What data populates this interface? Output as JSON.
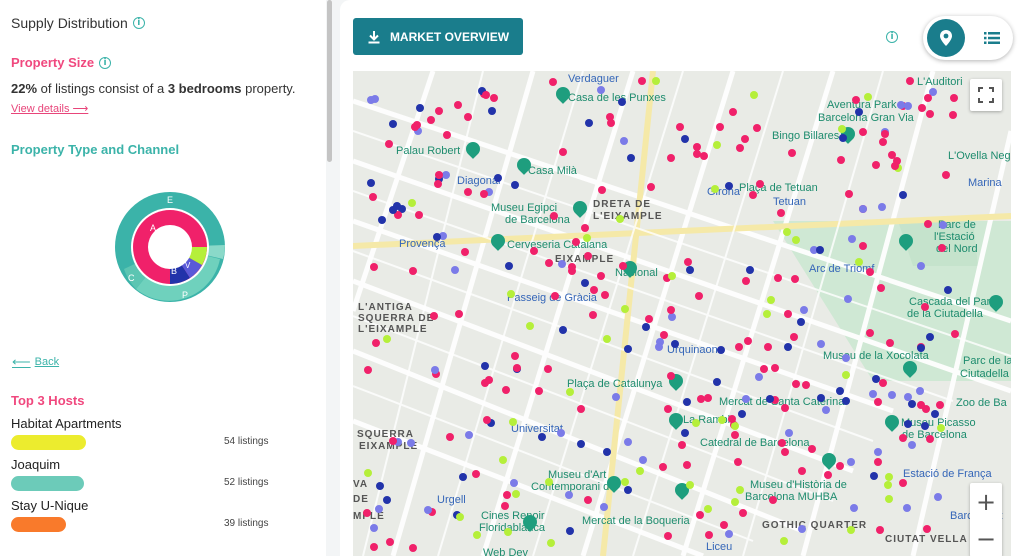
{
  "left": {
    "title": "Supply Distribution",
    "property_size": {
      "heading": "Property Size",
      "percent": "22%",
      "text_mid": " of listings consist of a ",
      "bold_value": "3 bedrooms",
      "text_end": " property.",
      "view_details": "View details ⟶"
    },
    "type_channel": {
      "heading": "Property Type and Channel",
      "donut_labels": {
        "E": "E",
        "A": "A",
        "B": "B",
        "V": "V",
        "C": "C",
        "P": "P"
      }
    },
    "back": "Back",
    "top_hosts": {
      "heading": "Top 3 Hosts",
      "hosts": [
        {
          "name": "Habitat Apartments",
          "count": "54 listings",
          "color": "#ecec2e"
        },
        {
          "name": "Joaquim",
          "count": "52 listings",
          "color": "#6ccbb9"
        },
        {
          "name": "Stay U-Nique",
          "count": "39 listings",
          "color": "#f97a2b"
        }
      ]
    }
  },
  "right": {
    "market_overview": "MARKET OVERVIEW",
    "view_toggle": {
      "active": "map-view",
      "inactive": "list-view"
    }
  },
  "map": {
    "labels": [
      {
        "text": "Verdaguer",
        "cls": "ml-blue"
      },
      {
        "text": "Casa de les Punxes",
        "cls": "ml-teal"
      },
      {
        "text": "L'Auditori",
        "cls": "ml-teal"
      },
      {
        "text": "Aventura Park",
        "cls": "ml-teal"
      },
      {
        "text": "Barcelona Gran Via",
        "cls": "ml-teal"
      },
      {
        "text": "Bingo Billares",
        "cls": "ml-teal"
      },
      {
        "text": "Palau Robert",
        "cls": "ml-teal"
      },
      {
        "text": "Casa Milà",
        "cls": "ml-teal"
      },
      {
        "text": "L'Ovella Negra",
        "cls": "ml-teal"
      },
      {
        "text": "Diagonal",
        "cls": "ml-blue"
      },
      {
        "text": "Girona",
        "cls": "ml-blue"
      },
      {
        "text": "Plaça de Tetuan",
        "cls": "ml-teal"
      },
      {
        "text": "Marina",
        "cls": "ml-blue"
      },
      {
        "text": "Museu Egipci",
        "cls": "ml-teal"
      },
      {
        "text": "de Barcelona",
        "cls": "ml-teal"
      },
      {
        "text": "DRETA DE",
        "cls": "ml-gray"
      },
      {
        "text": "L'EIXAMPLE",
        "cls": "ml-gray"
      },
      {
        "text": "Tetuan",
        "cls": "ml-blue"
      },
      {
        "text": "Parc de",
        "cls": "ml-teal"
      },
      {
        "text": "l'Estació",
        "cls": "ml-teal"
      },
      {
        "text": "del Nord",
        "cls": "ml-teal"
      },
      {
        "text": "Provença",
        "cls": "ml-blue"
      },
      {
        "text": "Cerveseria Catalana",
        "cls": "ml-teal"
      },
      {
        "text": "EIXAMPLE",
        "cls": "ml-gray"
      },
      {
        "text": "Nacional",
        "cls": "ml-teal"
      },
      {
        "text": "Arc de Triomf",
        "cls": "ml-blue"
      },
      {
        "text": "L'ANTIGA",
        "cls": "ml-gray"
      },
      {
        "text": "SQUERRA DE",
        "cls": "ml-gray"
      },
      {
        "text": "L'EIXAMPLE",
        "cls": "ml-gray"
      },
      {
        "text": "Passeig de Gràcia",
        "cls": "ml-blue"
      },
      {
        "text": "Cascada del Parc",
        "cls": "ml-teal"
      },
      {
        "text": "de la Ciutadella",
        "cls": "ml-teal"
      },
      {
        "text": "Urquinaona",
        "cls": "ml-blue"
      },
      {
        "text": "Museu de la Xocolata",
        "cls": "ml-teal"
      },
      {
        "text": "Parc de la",
        "cls": "ml-teal"
      },
      {
        "text": "Ciutadella",
        "cls": "ml-teal"
      },
      {
        "text": "Plaça de Catalunya",
        "cls": "ml-teal"
      },
      {
        "text": "Mercat de Santa Caterina",
        "cls": "ml-teal"
      },
      {
        "text": "Zoo de Ba",
        "cls": "ml-teal"
      },
      {
        "text": "La Rambla",
        "cls": "ml-teal"
      },
      {
        "text": "SQUERRA",
        "cls": "ml-gray"
      },
      {
        "text": "EIXAMPLE",
        "cls": "ml-gray"
      },
      {
        "text": "Universitat",
        "cls": "ml-blue"
      },
      {
        "text": "Catedral de Barcelona",
        "cls": "ml-teal"
      },
      {
        "text": "Museu Picasso",
        "cls": "ml-teal"
      },
      {
        "text": "de Barcelona",
        "cls": "ml-teal"
      },
      {
        "text": "Museu d'Art",
        "cls": "ml-teal"
      },
      {
        "text": "Contemporani de",
        "cls": "ml-teal"
      },
      {
        "text": "Museu d'Història de",
        "cls": "ml-teal"
      },
      {
        "text": "Barcelona MUHBA",
        "cls": "ml-teal"
      },
      {
        "text": "Estació de França",
        "cls": "ml-blue"
      },
      {
        "text": "Urgell",
        "cls": "ml-blue"
      },
      {
        "text": "Cines Renoir",
        "cls": "ml-teal"
      },
      {
        "text": "Floridablanca",
        "cls": "ml-teal"
      },
      {
        "text": "Mercat de la Boqueria",
        "cls": "ml-teal"
      },
      {
        "text": "GOTHIC QUARTER",
        "cls": "ml-gray"
      },
      {
        "text": "Barcelonet",
        "cls": "ml-blue"
      },
      {
        "text": "Liceu",
        "cls": "ml-blue"
      },
      {
        "text": "CIUTAT VELLA",
        "cls": "ml-gray"
      },
      {
        "text": "VA",
        "cls": "ml-gray"
      },
      {
        "text": "DE",
        "cls": "ml-gray"
      },
      {
        "text": "MPLE",
        "cls": "ml-gray"
      },
      {
        "text": "Web Dev",
        "cls": "ml-teal"
      }
    ],
    "listing_colors": {
      "pink": "#f0216a",
      "navy": "#2233aa",
      "violet": "#7b7be8",
      "lime": "#b5ef3a"
    },
    "zoom_in": "+",
    "zoom_out": "−"
  }
}
